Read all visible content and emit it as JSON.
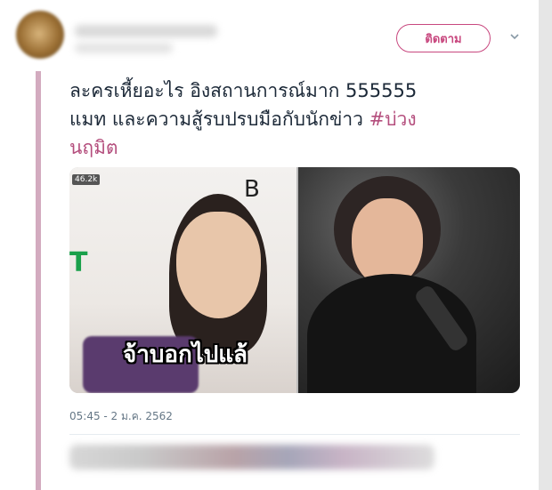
{
  "header": {
    "follow_label": "ติดตาม",
    "chevron_icon": "chevron-down-icon"
  },
  "tweet": {
    "text_line1": "ละครเหี้ยอะไร อิงสถานการณ์มาก 555555",
    "text_line2a": "แมท และความสู้รบปรบมือกับนักข่าว ",
    "hashtag": "#บ่วงนฤมิต",
    "hashtag_part1": "#บ่วง",
    "hashtag_part2": "นฤมิต",
    "timestamp": "05:45 - 2 ม.ค. 2562"
  },
  "media": {
    "view_badge": "46.2k",
    "caption": "จ้าบอกไปแล้",
    "sign_letter_b": "B",
    "sign_letter_t": "T"
  },
  "colors": {
    "accent": "#c8487f",
    "hashtag": "#b44e7d",
    "left_rule": "#d3abbf"
  }
}
